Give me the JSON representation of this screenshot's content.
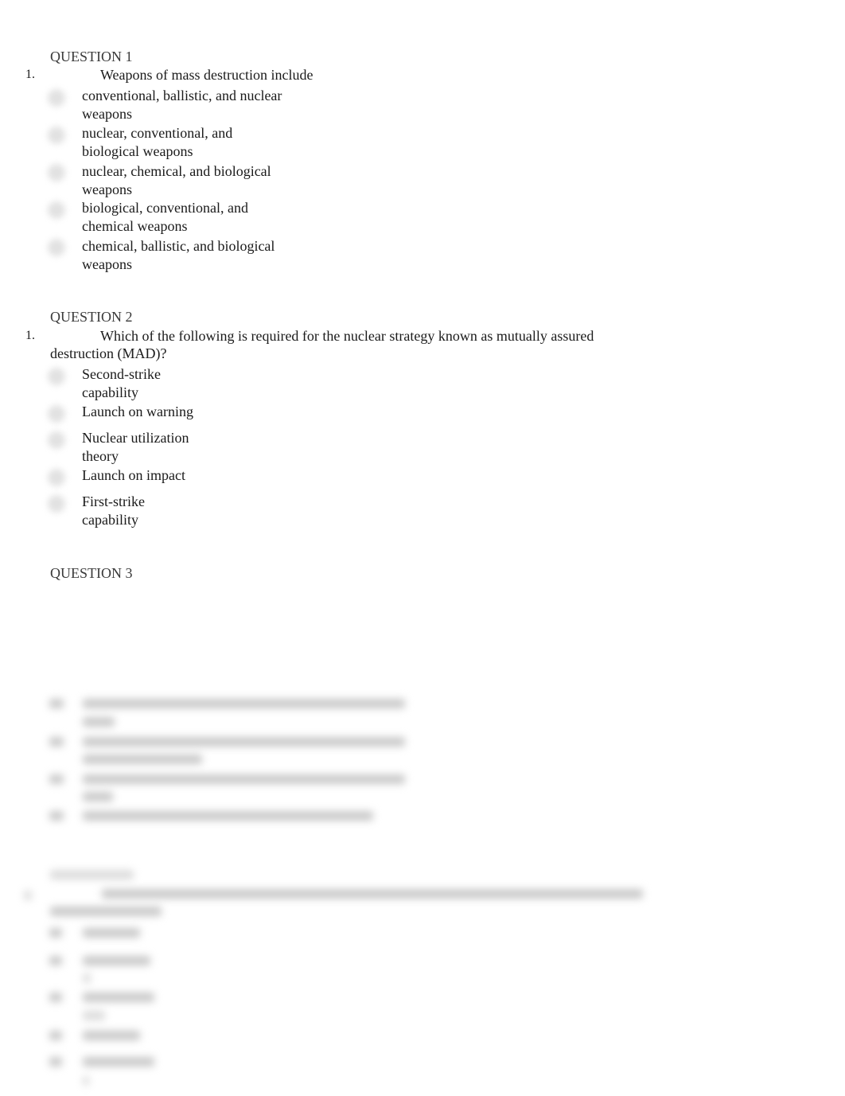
{
  "questions": [
    {
      "heading": "QUESTION 1",
      "number": "1.",
      "prompt": "Weapons of mass destruction include",
      "options": [
        {
          "line1": "conventional, ballistic, and nuclear",
          "line2": "weapons"
        },
        {
          "line1": "nuclear, conventional, and",
          "line2": "biological weapons"
        },
        {
          "line1": "nuclear, chemical, and biological",
          "line2": "weapons"
        },
        {
          "line1": "biological, conventional, and",
          "line2": "chemical weapons"
        },
        {
          "line1": "chemical, ballistic, and biological",
          "line2": "weapons"
        }
      ]
    },
    {
      "heading": "QUESTION 2",
      "number": "1.",
      "prompt": "Which of the following is required for the nuclear strategy known as mutually assured destruction (MAD)?",
      "options": [
        {
          "line1": "Second-strike",
          "line2": "capability"
        },
        {
          "line1": "Launch on warning",
          "line2": ""
        },
        {
          "line1": "Nuclear utilization",
          "line2": "theory"
        },
        {
          "line1": "Launch on impact",
          "line2": ""
        },
        {
          "line1": "First-strike",
          "line2": "capability"
        }
      ]
    },
    {
      "heading": "QUESTION 3",
      "blurred": true
    },
    {
      "heading": "",
      "blurred": true
    }
  ],
  "icons": {
    "radio": "radio-button-icon"
  }
}
